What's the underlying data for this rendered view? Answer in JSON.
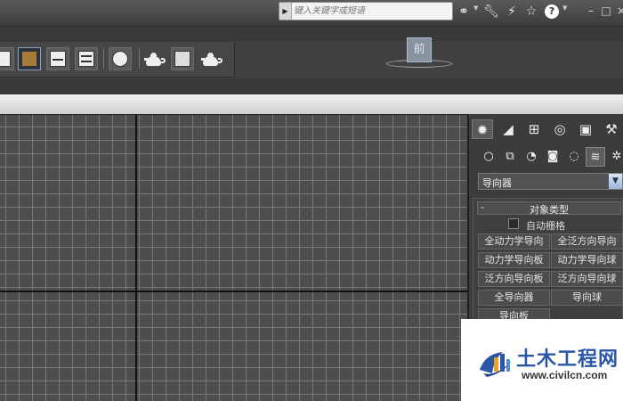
{
  "titlebar": {
    "search_placeholder": "键入关键字或短语",
    "window_controls": {
      "minimize": "–",
      "restore": "□",
      "close": "×"
    }
  },
  "toolbar": {
    "icons": [
      "render-setup-icon",
      "rendered-frame-window-icon",
      "curve-editor-icon",
      "schematic-view-icon",
      "material-editor-icon",
      "render-icon"
    ]
  },
  "viewport": {
    "viewcube_label": "前"
  },
  "command_panel": {
    "tabs": [
      "create",
      "modify",
      "hierarchy",
      "motion",
      "display",
      "utilities"
    ],
    "category": "导向器",
    "rollout_title": "对象类型",
    "rollout_toggle": "-",
    "autogrid_label": "自动栅格",
    "buttons": [
      "全动力学导向",
      "全泛方向导向",
      "动力学导向板",
      "动力学导向球",
      "泛方向导向板",
      "泛方向导向球",
      "全导向器",
      "导向球",
      "导向板"
    ]
  },
  "watermark": {
    "title": "土木工程网",
    "url": "www.civilcn.com",
    "colors": {
      "primary": "#2a56a8",
      "accent": "#f0a020"
    }
  }
}
